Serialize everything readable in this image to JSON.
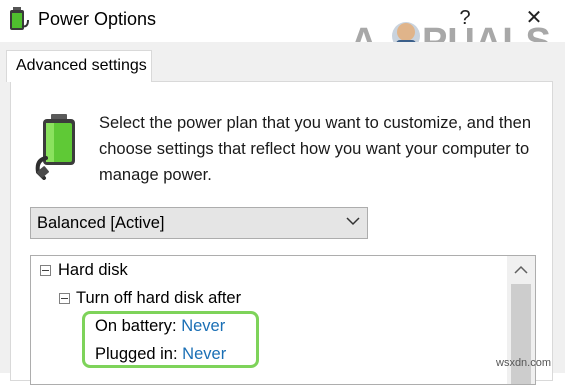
{
  "window": {
    "title": "Power Options",
    "help_glyph": "?",
    "close_glyph": "✕"
  },
  "tabs": [
    {
      "label": "Advanced settings",
      "selected": true
    }
  ],
  "description": "Select the power plan that you want to customize, and then choose settings that reflect how you want your computer to manage power.",
  "plan_select": {
    "value": "Balanced [Active]"
  },
  "tree": {
    "root": {
      "label": "Hard disk",
      "expanded": true
    },
    "child": {
      "label": "Turn off hard disk after",
      "expanded": true
    },
    "settings": [
      {
        "label": "On battery:",
        "value": "Never"
      },
      {
        "label": "Plugged in:",
        "value": "Never"
      }
    ]
  },
  "watermark": {
    "text_a": "A",
    "text_rest": "PUALS"
  },
  "source_tag": "wsxdn.com",
  "colors": {
    "link": "#1a6fb5",
    "highlight": "#7ed35a",
    "panel_bg": "#f0f0f0"
  },
  "icons": {
    "app": "power-options-battery-icon",
    "plan": "battery-plug-icon"
  }
}
